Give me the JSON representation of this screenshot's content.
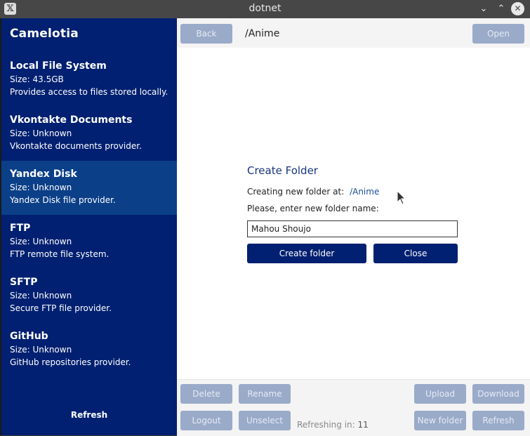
{
  "window": {
    "title": "dotnet",
    "app_icon": "x-logo-icon"
  },
  "sidebar": {
    "brand": "Camelotia",
    "providers": [
      {
        "name": "Local File System",
        "size": "Size: 43.5GB",
        "desc": "Provides access to files stored locally."
      },
      {
        "name": "Vkontakte Documents",
        "size": "Size: Unknown",
        "desc": "Vkontakte documents provider."
      },
      {
        "name": "Yandex Disk",
        "size": "Size: Unknown",
        "desc": "Yandex Disk file provider."
      },
      {
        "name": "FTP",
        "size": "Size: Unknown",
        "desc": "FTP remote file system."
      },
      {
        "name": "SFTP",
        "size": "Size: Unknown",
        "desc": "Secure FTP file provider."
      },
      {
        "name": "GitHub",
        "size": "Size: Unknown",
        "desc": "GitHub repositories provider."
      }
    ],
    "selected_provider": "Yandex Disk",
    "refresh_label": "Refresh"
  },
  "toolbar": {
    "back_label": "Back",
    "path": "/Anime",
    "open_label": "Open"
  },
  "dialog": {
    "title": "Create Folder",
    "creating_at_label": "Creating new folder at:",
    "creating_at_path": "/Anime",
    "name_prompt": "Please, enter new folder name:",
    "folder_name_value": "Mahou Shoujo",
    "create_label": "Create folder",
    "close_label": "Close"
  },
  "bottom": {
    "delete_label": "Delete",
    "rename_label": "Rename",
    "upload_label": "Upload",
    "download_label": "Download",
    "logout_label": "Logout",
    "unselect_label": "Unselect",
    "refreshing_label": "Refreshing in:",
    "refreshing_value": "11",
    "new_folder_label": "New folder",
    "refresh_label": "Refresh"
  },
  "colors": {
    "sidebar_bg": "#012071",
    "selected_bg": "#0b3f87",
    "primary": "#012071",
    "disabled": "#9aaac9"
  }
}
